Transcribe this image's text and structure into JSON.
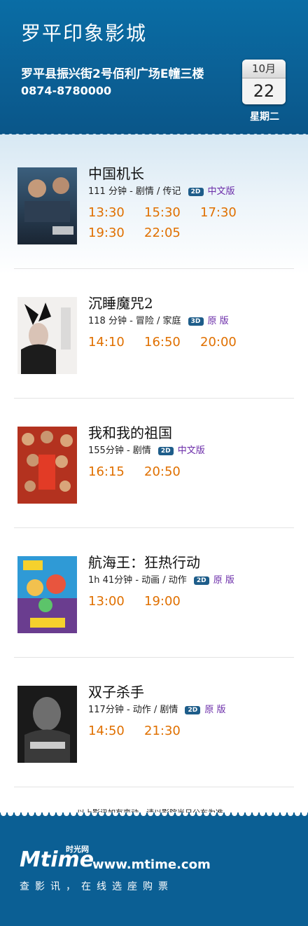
{
  "header": {
    "cinema_name": "罗平印象影城",
    "address": "罗平县振兴街2号佰利广场E幢三楼",
    "phone": "0874-8780000",
    "date": {
      "month": "10月",
      "day": "22",
      "weekday": "星期二"
    }
  },
  "movies": [
    {
      "title": "中国机长",
      "meta": "111 分钟 - 剧情 / 传记",
      "format": "2D",
      "version": "中文版",
      "times": [
        "13:30",
        "15:30",
        "17:30",
        "19:30",
        "22:05"
      ]
    },
    {
      "title": "沉睡魔咒2",
      "meta": "118 分钟 - 冒险 / 家庭",
      "format": "3D",
      "version": "原 版",
      "times": [
        "14:10",
        "16:50",
        "20:00"
      ]
    },
    {
      "title": "我和我的祖国",
      "meta": "155分钟 - 剧情",
      "format": "2D",
      "version": "中文版",
      "times": [
        "16:15",
        "20:50"
      ]
    },
    {
      "title": "航海王：狂热行动",
      "meta": "1h 41分钟 - 动画 / 动作",
      "format": "2D",
      "version": "原 版",
      "times": [
        "13:00",
        "19:00"
      ]
    },
    {
      "title": "双子杀手",
      "meta": "117分钟 - 动作 / 剧情",
      "format": "2D",
      "version": "原 版",
      "times": [
        "14:50",
        "21:30"
      ]
    }
  ],
  "notice": "以上影讯如有变动，请以影院当日公布为准。",
  "footer": {
    "logo_main": "Mtime",
    "logo_sub": "时光网",
    "url": "www.mtime.com",
    "slogan": "查影讯，在线选座购票"
  },
  "colors": {
    "header_blue": "#0b5f94",
    "showtime_orange": "#e07000",
    "version_purple": "#6a2ba8"
  }
}
